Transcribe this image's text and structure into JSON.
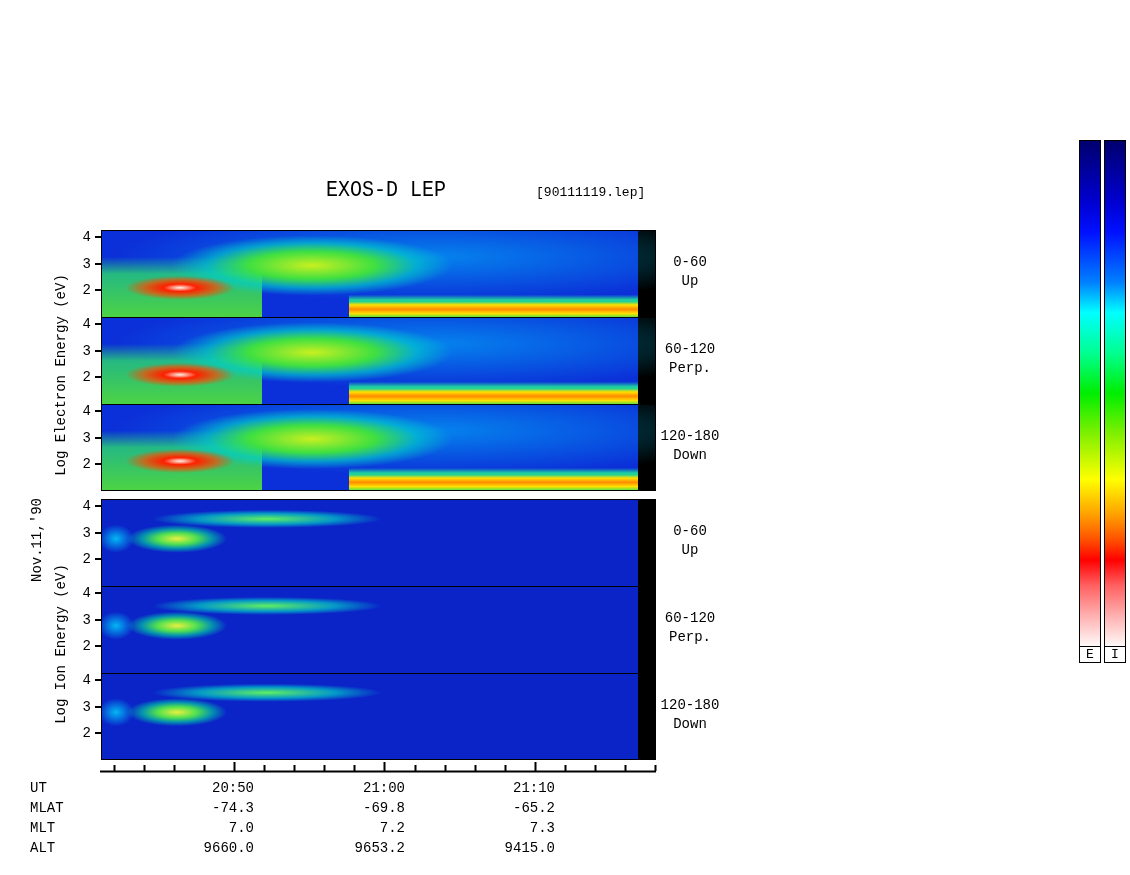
{
  "title": "EXOS-D LEP",
  "file_label": "[90111119.lep]",
  "date_label": "Nov.11,'90",
  "groups": [
    {
      "kind": "electron",
      "axis_label": "Log Electron Energy (eV)",
      "panels": [
        {
          "range": "0-60",
          "direction": "Up",
          "y_ticks": [
            "4",
            "3",
            "2"
          ]
        },
        {
          "range": "60-120",
          "direction": "Perp.",
          "y_ticks": [
            "4",
            "3",
            "2"
          ]
        },
        {
          "range": "120-180",
          "direction": "Down",
          "y_ticks": [
            "4",
            "3",
            "2"
          ]
        }
      ]
    },
    {
      "kind": "ion",
      "axis_label": "Log Ion Energy (eV)",
      "panels": [
        {
          "range": "0-60",
          "direction": "Up",
          "y_ticks": [
            "4",
            "3",
            "2"
          ]
        },
        {
          "range": "60-120",
          "direction": "Perp.",
          "y_ticks": [
            "4",
            "3",
            "2"
          ]
        },
        {
          "range": "120-180",
          "direction": "Down",
          "y_ticks": [
            "4",
            "3",
            "2"
          ]
        }
      ]
    }
  ],
  "coordinates": [
    {
      "label": "UT",
      "values": [
        "20:50",
        "21:00",
        "21:10"
      ]
    },
    {
      "label": "MLAT",
      "values": [
        "-74.3",
        "-69.8",
        "-65.2"
      ]
    },
    {
      "label": "MLT",
      "values": [
        "7.0",
        "7.2",
        "7.3"
      ]
    },
    {
      "label": "ALT",
      "values": [
        "9660.0",
        "9653.2",
        "9415.0"
      ]
    }
  ],
  "color_bars": [
    {
      "label": "E"
    },
    {
      "label": "I"
    }
  ]
}
